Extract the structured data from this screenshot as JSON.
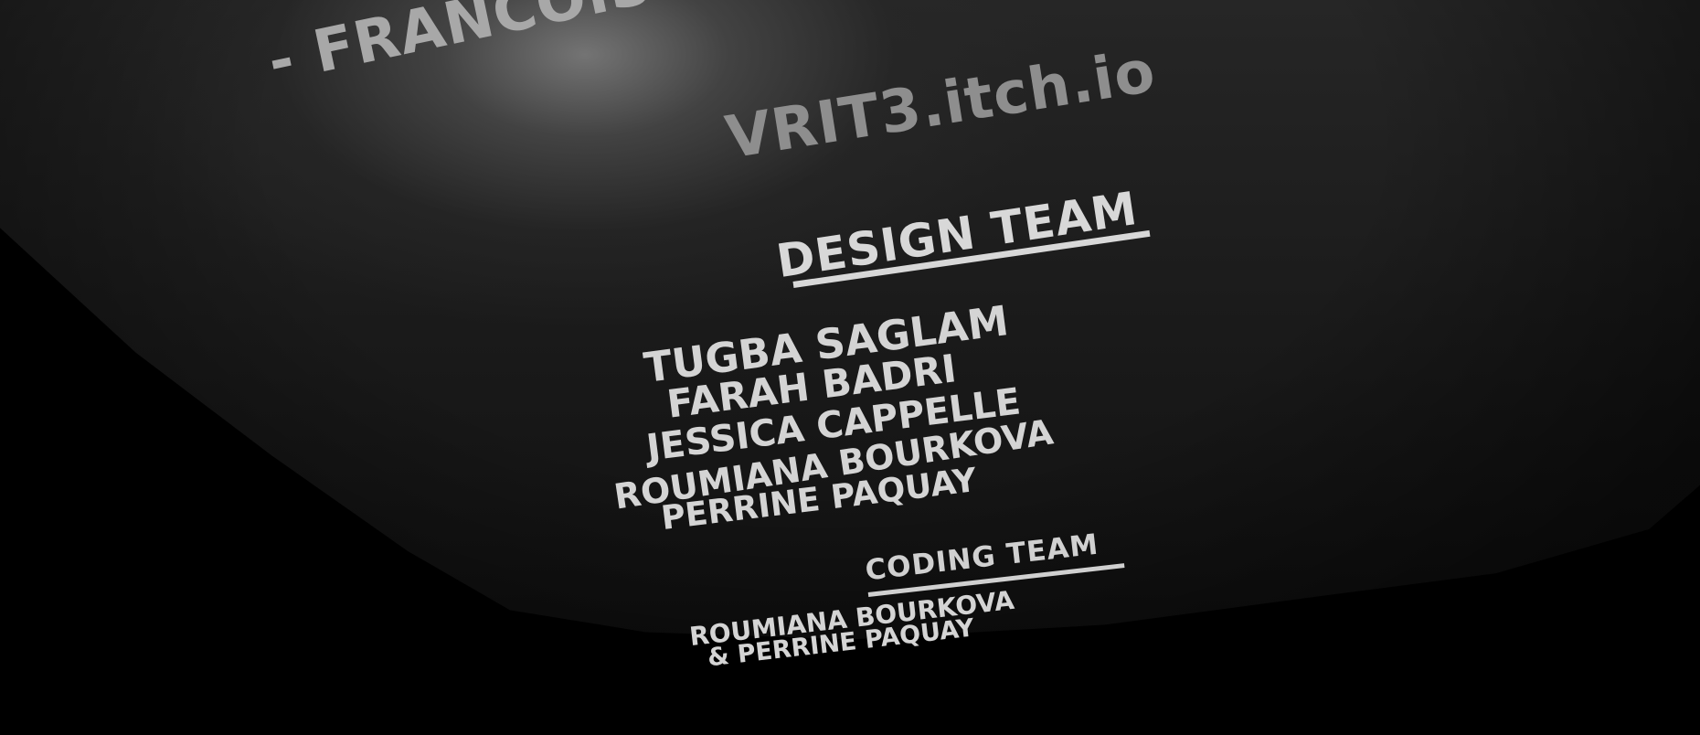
{
  "credits": {
    "top_line": "- FRANCOIS",
    "site": "VRIT3.itch.io",
    "design_heading": "DESIGN TEAM",
    "design_members": [
      "TUGBA SAGLAM",
      "FARAH BADRI",
      "JESSICA CAPPELLE",
      "ROUMIANA BOURKOVA",
      "PERRINE PAQUAY"
    ],
    "coding_heading": "CODING TEAM",
    "coding_members": [
      "ROUMIANA BOURKOVA",
      "& PERRINE PAQUAY"
    ]
  },
  "colors": {
    "background": "#000000",
    "text_light": "#d4d4d4",
    "text_dim": "#8e8e8e"
  }
}
